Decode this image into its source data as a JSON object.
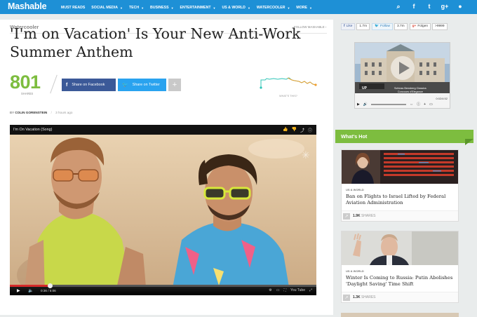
{
  "nav": {
    "logo": "Mashable",
    "items": [
      {
        "label": "MUST READS",
        "caret": false
      },
      {
        "label": "SOCIAL MEDIA",
        "caret": true
      },
      {
        "label": "TECH",
        "caret": true
      },
      {
        "label": "BUSINESS",
        "caret": true
      },
      {
        "label": "ENTERTAINMENT",
        "caret": true
      },
      {
        "label": "US & WORLD",
        "caret": true
      },
      {
        "label": "WATERCOOLER",
        "caret": true
      },
      {
        "label": "MORE",
        "caret": true
      }
    ],
    "caret_glyph": "▼",
    "icons": [
      "search-icon",
      "facebook-icon",
      "twitter-icon",
      "google-plus-icon",
      "user-icon"
    ],
    "icon_glyphs": {
      "search": "⌕",
      "facebook": "f",
      "twitter": "t",
      "gplus": "g+",
      "user": "●"
    }
  },
  "article": {
    "channel": "Watercooler",
    "follow_label": "FOLLOW MASHABLE ›",
    "title": "'I'm on Vacation' Is Your New Anti-Work Summer Anthem",
    "share_count": "801",
    "shares_label": "SHARES",
    "facebook_button": "Share on Facebook",
    "twitter_button": "Share on Twitter",
    "plus_button": "+",
    "whats_this": "WHAT'S THIS?",
    "byline_prefix": "BY",
    "author": "COLIN GORENSTEIN",
    "time_ago": "3 hours ago"
  },
  "video": {
    "title": "I'm On Vacation (Song)",
    "time": "0:36 / 5:06",
    "progress": 0.13,
    "right_controls": [
      "⚙",
      "▭",
      "⛶",
      "You Tube",
      "⤢"
    ]
  },
  "social_bar": {
    "like_label": "Like",
    "like_count": "1.7m",
    "follow_label": "Follow",
    "follow_count": "3.7m",
    "gplus_label": "Folgen",
    "gplus_count": ">9999"
  },
  "ad": {
    "caption_line1": "Schloss Bensberg Classics",
    "caption_line2": "Concours d'Elegance",
    "time": "0:02/4:52"
  },
  "whats_hot": {
    "title": "What's Hot",
    "cards": [
      {
        "channel": "US & WORLD",
        "title": "Ban on Flights to Israel Lifted by Federal Aviation Administration",
        "shares": "1.9K",
        "shares_label": "SHARES"
      },
      {
        "channel": "US & WORLD",
        "title": "Winter Is Coming to Russia: Putin Abolishes 'Daylight Saving' Time Shift",
        "shares": "1.3K",
        "shares_label": "SHARES"
      }
    ]
  },
  "colors": {
    "nav_blue": "#1e90d6",
    "share_green": "#7dbd3f",
    "facebook_blue": "#3b5998",
    "twitter_blue": "#2aa3ef",
    "hot_green": "#7dbd3f"
  }
}
